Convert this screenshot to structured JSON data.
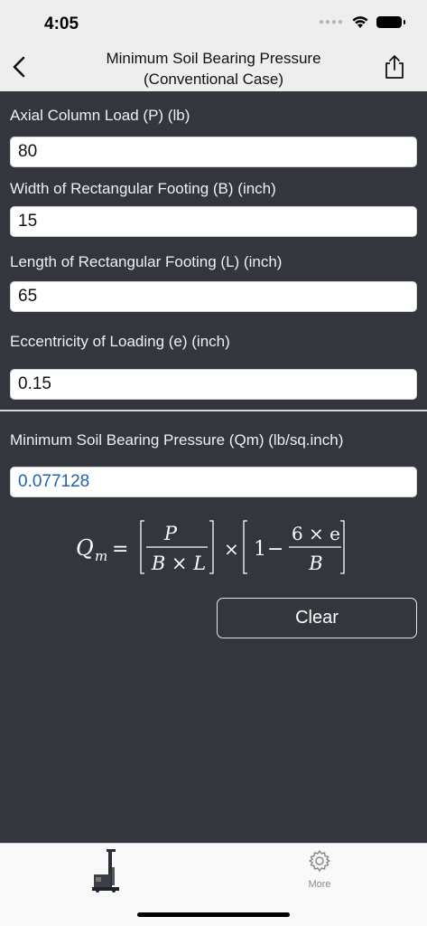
{
  "status": {
    "time": "4:05"
  },
  "nav": {
    "title_line1": "Minimum Soil Bearing Pressure",
    "title_line2": "(Conventional Case)"
  },
  "inputs": [
    {
      "label": "Axial Column Load (P) (lb)",
      "value": "80"
    },
    {
      "label": "Width of Rectangular Footing (B) (inch)",
      "value": "15"
    },
    {
      "label": "Length of Rectangular Footing (L) (inch)",
      "value": "65"
    },
    {
      "label": "Eccentricity of Loading (e) (inch)",
      "value": "0.15"
    }
  ],
  "result": {
    "label": "Minimum Soil Bearing Pressure (Qm) (lb/sq.inch)",
    "value": "0.077128"
  },
  "formula": {
    "lhs": "Q",
    "lhs_sub": "m",
    "equals": "=",
    "frac1_num": "P",
    "frac1_den": "B × L",
    "times": "×",
    "one": "1",
    "minus": "−",
    "frac2_num": "6 × e",
    "frac2_den": "B"
  },
  "actions": {
    "clear_label": "Clear"
  },
  "tabbar": {
    "more_label": "More"
  },
  "colors": {
    "background": "#33363d",
    "bar": "#eeeeef",
    "result_text": "#1f64b0"
  }
}
